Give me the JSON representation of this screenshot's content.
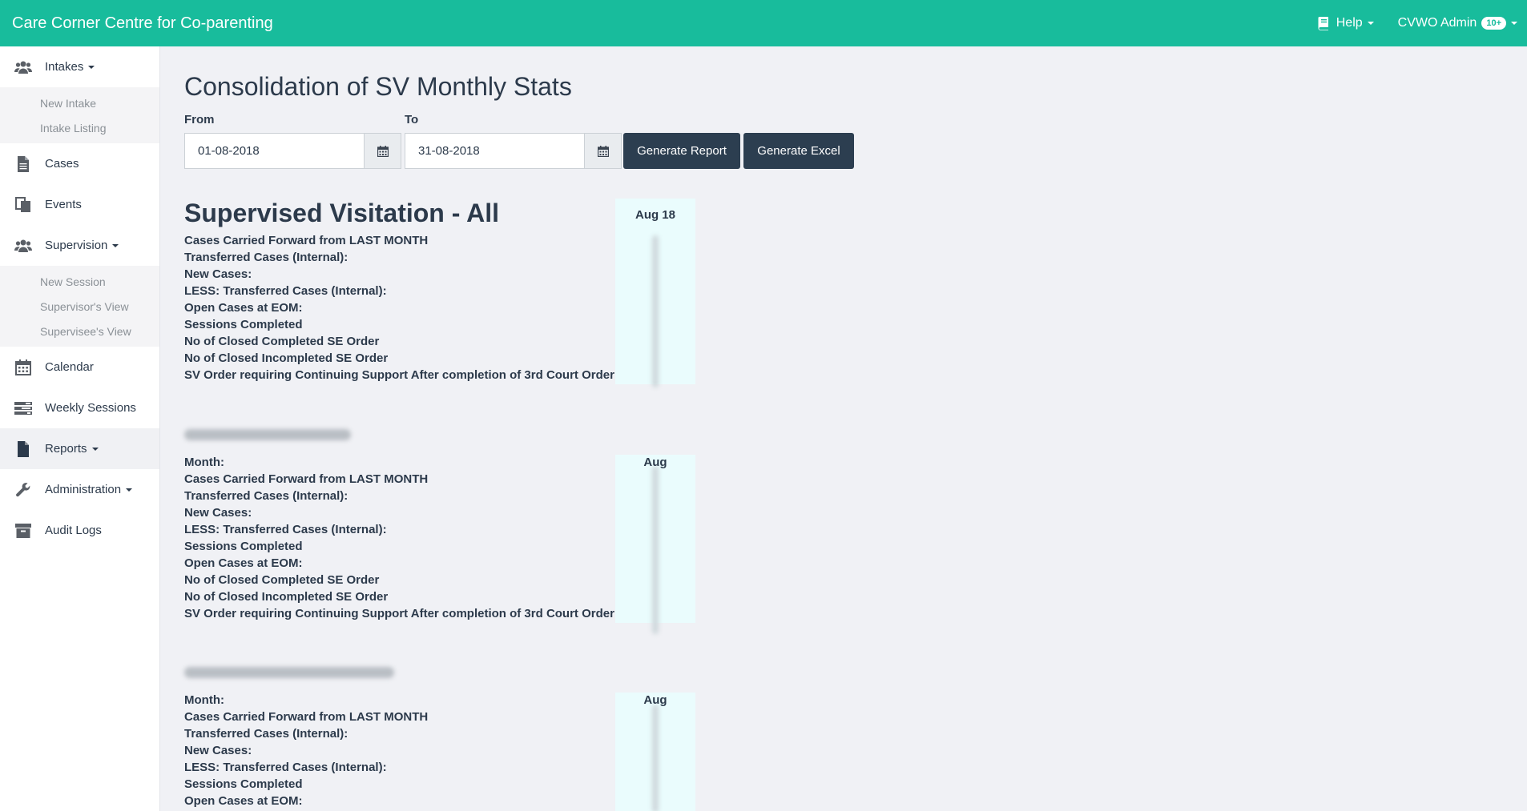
{
  "app": {
    "brand": "Care Corner Centre for Co-parenting",
    "help_label": "Help",
    "user_label": "CVWO Admin",
    "notification_badge": "10+"
  },
  "sidebar": {
    "intakes_label": "Intakes",
    "intakes_sub": [
      "New Intake",
      "Intake Listing"
    ],
    "cases_label": "Cases",
    "events_label": "Events",
    "supervision_label": "Supervision",
    "supervision_sub": [
      "New Session",
      "Supervisor's View",
      "Supervisee's View"
    ],
    "calendar_label": "Calendar",
    "weekly_sessions_label": "Weekly Sessions",
    "reports_label": "Reports",
    "administration_label": "Administration",
    "audit_logs_label": "Audit Logs"
  },
  "page": {
    "title": "Consolidation of SV Monthly Stats",
    "from_label": "From",
    "from_value": "01-08-2018",
    "to_label": "To",
    "to_value": "31-08-2018",
    "generate_report_label": "Generate Report",
    "generate_excel_label": "Generate Excel"
  },
  "report": {
    "section1": {
      "title": "Supervised Visitation - All",
      "column_header": "Aug 18",
      "rows": [
        "Cases Carried Forward from LAST MONTH",
        "Transferred Cases (Internal):",
        "New Cases:",
        "LESS: Transferred Cases (Internal):",
        "Open Cases at EOM:",
        "Sessions Completed",
        "No of Closed Completed SE Order",
        "No of Closed Incompleted SE Order",
        "SV Order requiring Continuing Support After completion of 3rd Court Order"
      ]
    },
    "section2": {
      "column_header": "Aug",
      "rows": [
        "Month:",
        "Cases Carried Forward from LAST MONTH",
        "Transferred Cases (Internal):",
        "New Cases:",
        "LESS: Transferred Cases (Internal):",
        "Sessions Completed",
        "Open Cases at EOM:",
        "No of Closed Completed SE Order",
        "No of Closed Incompleted SE Order",
        "SV Order requiring Continuing Support After completion of 3rd Court Order"
      ]
    },
    "section3": {
      "column_header": "Aug",
      "rows": [
        "Month:",
        "Cases Carried Forward from LAST MONTH",
        "Transferred Cases (Internal):",
        "New Cases:",
        "LESS: Transferred Cases (Internal):",
        "Sessions Completed",
        "Open Cases at EOM:"
      ]
    }
  },
  "colors": {
    "topbar": "#18bc9c",
    "button": "#2c3e50",
    "column_highlight": "#eafcfd"
  }
}
